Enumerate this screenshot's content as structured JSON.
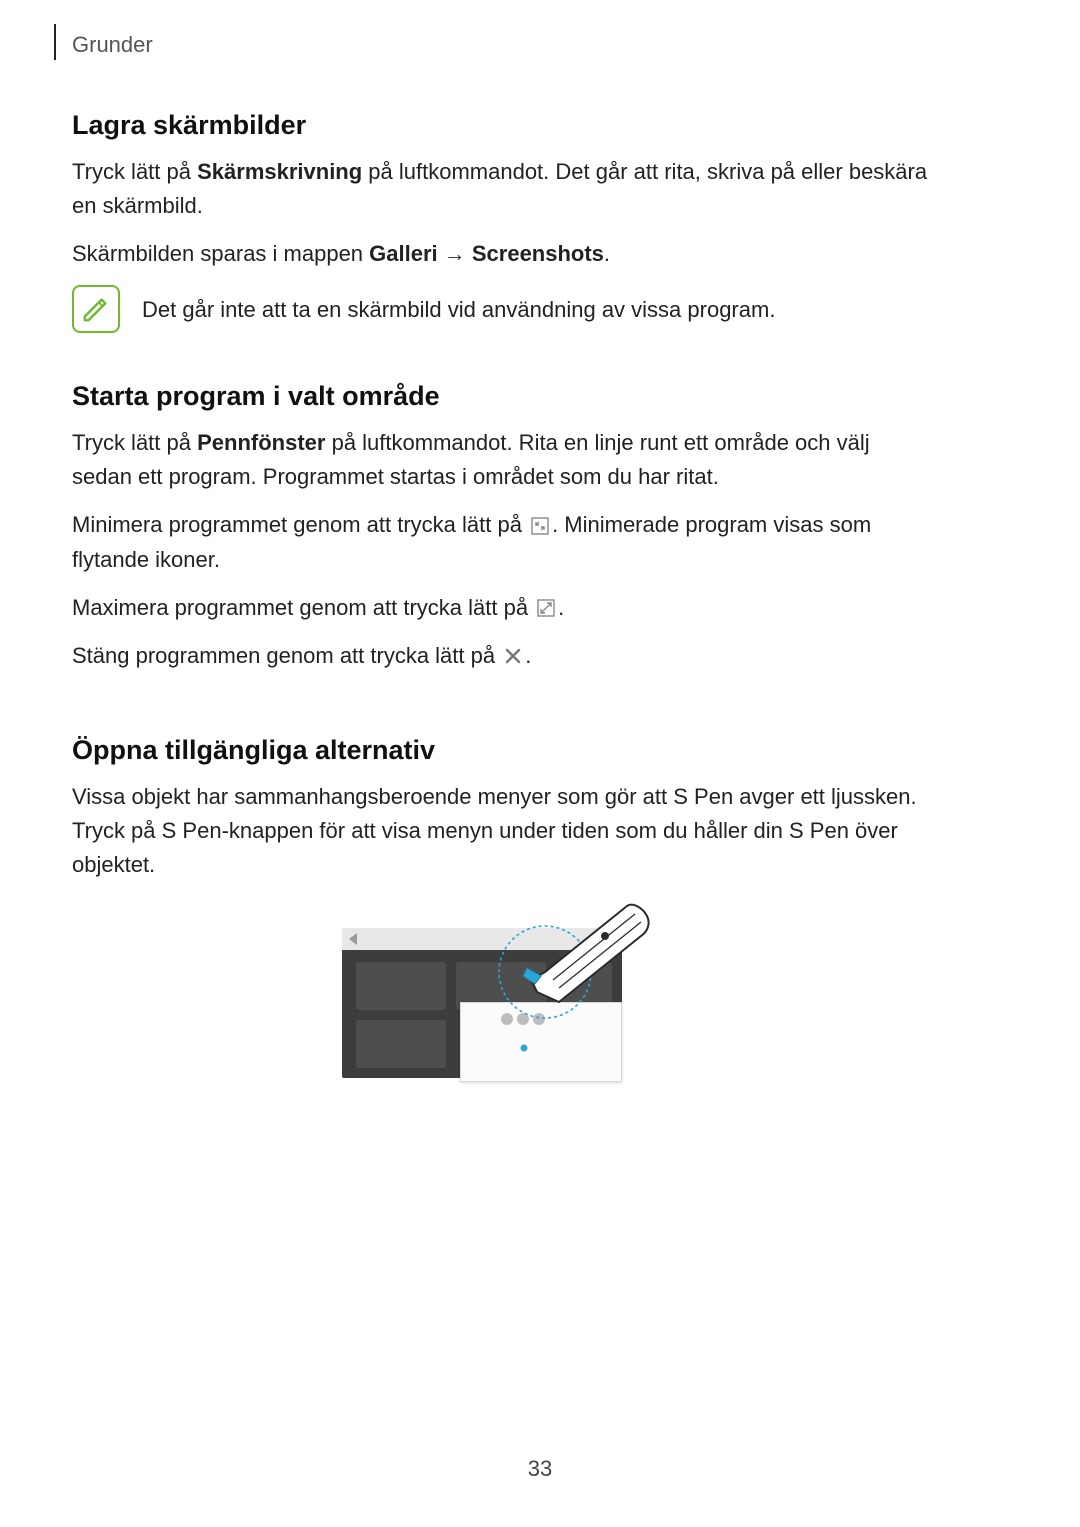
{
  "header": {
    "section_label": "Grunder"
  },
  "s1": {
    "title": "Lagra skärmbilder",
    "p1_a": "Tryck lätt på ",
    "p1_bold": "Skärmskrivning",
    "p1_b": " på luftkommandot. Det går att rita, skriva på eller beskära en skärmbild.",
    "p2_a": "Skärmbilden sparas i mappen ",
    "p2_bold": "Galleri → Screenshots",
    "p2_b": ".",
    "note": "Det går inte att ta en skärmbild vid användning av vissa program."
  },
  "s2": {
    "title": "Starta program i valt område",
    "p1_a": "Tryck lätt på ",
    "p1_bold": "Pennfönster",
    "p1_b": " på luftkommandot. Rita en linje runt ett område och välj sedan ett program. Programmet startas i området som du har ritat.",
    "p2_a": "Minimera programmet genom att trycka lätt på ",
    "p2_b": ". Minimerade program visas som flytande ikoner.",
    "p3_a": "Maximera programmet genom att trycka lätt på ",
    "p3_b": ".",
    "p4_a": "Stäng programmen genom att trycka lätt på ",
    "p4_b": "."
  },
  "s3": {
    "title": "Öppna tillgängliga alternativ",
    "p1": "Vissa objekt har sammanhangsberoende menyer som gör att S Pen avger ett ljussken. Tryck på S Pen-knappen för att visa menyn under tiden som du håller din S Pen över objektet."
  },
  "page_number": "33"
}
